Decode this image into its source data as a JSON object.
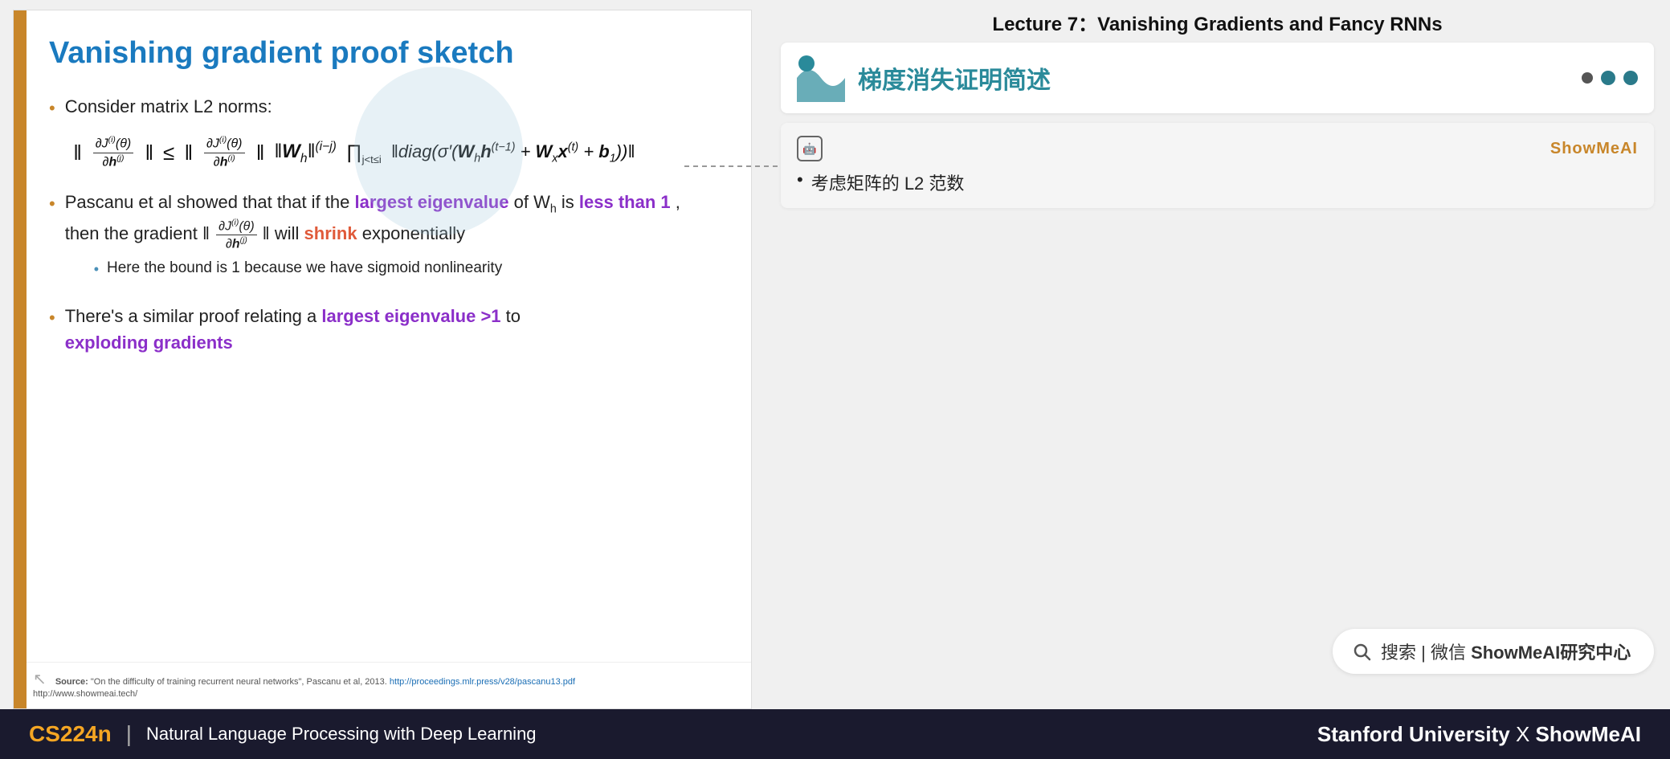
{
  "lecture": {
    "title": "Lecture 7：Vanishing Gradients and Fancy RNNs"
  },
  "slide": {
    "title": "Vanishing gradient proof sketch",
    "left_bar_color": "#C8862A",
    "bullets": [
      {
        "id": "b1",
        "text_prefix": "Consider matrix L2 norms:"
      },
      {
        "id": "b2",
        "text_plain": "Pascanu et al showed that that if the ",
        "highlight1": "largest eigenvalue",
        "text_mid": " of W",
        "text_mid2": " is less than 1",
        "text_3": ", then the gradient ",
        "text_4": " will ",
        "highlight2": "shrink",
        "text_5": " exponentially",
        "sub_bullet": "Here the bound is 1 because we have sigmoid nonlinearity"
      },
      {
        "id": "b3",
        "text_plain": "There's a similar proof relating a ",
        "highlight1": "largest eigenvalue >1",
        "text_mid": " to ",
        "highlight2": "exploding gradients"
      }
    ],
    "footer": {
      "source_label": "Source:",
      "source_text": "\"On the difficulty of training recurrent neural networks\", Pascanu et al, 2013.",
      "source_link": "http://proceedings.mlr.press/v28/pascanu13.pdf",
      "url": "http://www.showmeai.tech/"
    }
  },
  "right_panel": {
    "slide_header_title": "梯度消失证明简述",
    "nav_dots": [
      "dot1",
      "dot2",
      "dot3"
    ],
    "annotation": {
      "ai_icon": "AI",
      "brand": "ShowMeAI",
      "bullet": "考虑矩阵的 L2 范数"
    },
    "search_bar": {
      "icon": "search",
      "text": "搜索 | 微信 ShowMeAI研究中心"
    }
  },
  "bottom_bar": {
    "course_id": "CS224n",
    "divider": "|",
    "course_name": "Natural Language Processing with Deep Learning",
    "university": "Stanford University",
    "cross": "X",
    "brand": "ShowMeAI"
  }
}
